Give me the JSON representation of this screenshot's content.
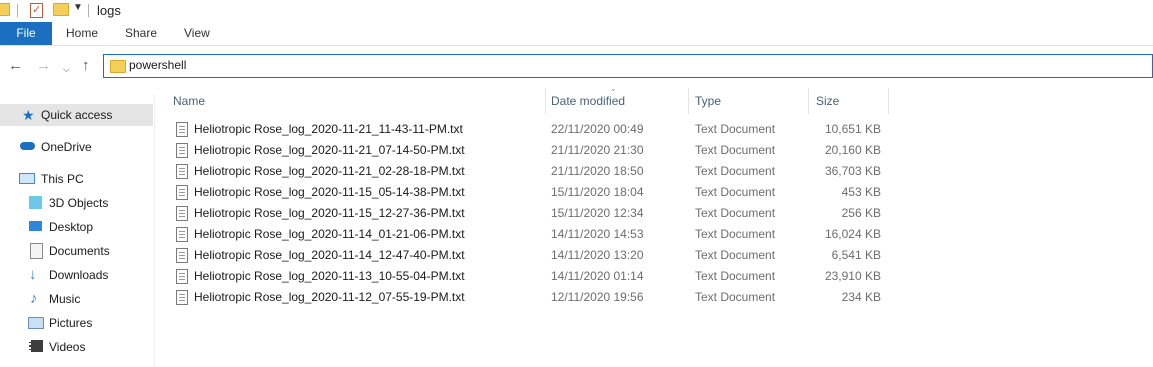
{
  "window": {
    "title": "logs"
  },
  "ribbon": {
    "tabs": [
      "File",
      "Home",
      "Share",
      "View"
    ]
  },
  "address": {
    "folder": "powershell"
  },
  "nav": {
    "items": [
      {
        "label": "Quick access",
        "icon": "star-icon",
        "selected": true
      },
      {
        "label": "OneDrive",
        "icon": "cloud-icon"
      },
      {
        "label": "This PC",
        "icon": "computer-icon"
      },
      {
        "label": "3D Objects",
        "icon": "cube-icon"
      },
      {
        "label": "Desktop",
        "icon": "desktop-icon"
      },
      {
        "label": "Documents",
        "icon": "documents-icon"
      },
      {
        "label": "Downloads",
        "icon": "download-arrow-icon"
      },
      {
        "label": "Music",
        "icon": "music-note-icon"
      },
      {
        "label": "Pictures",
        "icon": "pictures-icon"
      },
      {
        "label": "Videos",
        "icon": "film-icon"
      }
    ]
  },
  "columns": {
    "name": "Name",
    "date": "Date modified",
    "type": "Type",
    "size": "Size"
  },
  "files": [
    {
      "name": "Heliotropic Rose_log_2020-11-21_11-43-11-PM.txt",
      "date": "22/11/2020 00:49",
      "type": "Text Document",
      "size": "10,651 KB"
    },
    {
      "name": "Heliotropic Rose_log_2020-11-21_07-14-50-PM.txt",
      "date": "21/11/2020 21:30",
      "type": "Text Document",
      "size": "20,160 KB"
    },
    {
      "name": "Heliotropic Rose_log_2020-11-21_02-28-18-PM.txt",
      "date": "21/11/2020 18:50",
      "type": "Text Document",
      "size": "36,703 KB"
    },
    {
      "name": "Heliotropic Rose_log_2020-11-15_05-14-38-PM.txt",
      "date": "15/11/2020 18:04",
      "type": "Text Document",
      "size": "453 KB"
    },
    {
      "name": "Heliotropic Rose_log_2020-11-15_12-27-36-PM.txt",
      "date": "15/11/2020 12:34",
      "type": "Text Document",
      "size": "256 KB"
    },
    {
      "name": "Heliotropic Rose_log_2020-11-14_01-21-06-PM.txt",
      "date": "14/11/2020 14:53",
      "type": "Text Document",
      "size": "16,024 KB"
    },
    {
      "name": "Heliotropic Rose_log_2020-11-14_12-47-40-PM.txt",
      "date": "14/11/2020 13:20",
      "type": "Text Document",
      "size": "6,541 KB"
    },
    {
      "name": "Heliotropic Rose_log_2020-11-13_10-55-04-PM.txt",
      "date": "14/11/2020 01:14",
      "type": "Text Document",
      "size": "23,910 KB"
    },
    {
      "name": "Heliotropic Rose_log_2020-11-12_07-55-19-PM.txt",
      "date": "12/11/2020 19:56",
      "type": "Text Document",
      "size": "234 KB"
    }
  ],
  "colors": {
    "accent": "#1a6fc1",
    "folder": "#f3cf5a",
    "header_text": "#4c607a"
  }
}
